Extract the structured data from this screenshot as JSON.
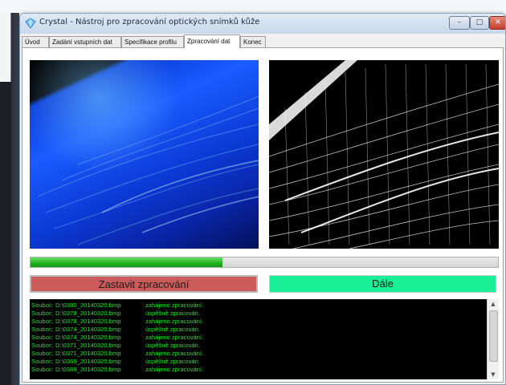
{
  "window": {
    "title": "Crystal - Nástroj pro zpracování optických snímků kůže",
    "buttons": {
      "minimize": "–",
      "maximize": "□",
      "close": "✕"
    }
  },
  "tabs": [
    {
      "label": "Úvod",
      "active": false
    },
    {
      "label": "Zadání vstupních dat",
      "active": false
    },
    {
      "label": "Specifikace profilu",
      "active": false
    },
    {
      "label": "Zpracování dat",
      "active": true
    },
    {
      "label": "Konec",
      "active": false
    }
  ],
  "progress": {
    "value": 0.41
  },
  "actions": {
    "stop_label": "Zastavit zpracování",
    "next_label": "Dále"
  },
  "colors": {
    "stop_button": "#cc5b5b",
    "next_button": "#19f098",
    "log_text": "#19e81f",
    "progress": "#1fb11f"
  },
  "log": [
    {
      "label": "Soubor:",
      "file": "D:\\0380_20140320.bmp",
      "status": "zahájeno zpracování."
    },
    {
      "label": "Soubor:",
      "file": "D:\\0378_20140320.bmp",
      "status": "úspěšně zpracován."
    },
    {
      "label": "Soubor:",
      "file": "D:\\0378_20140320.bmp",
      "status": "zahájeno zpracování."
    },
    {
      "label": "Soubor:",
      "file": "D:\\0374_20140320.bmp",
      "status": "úspěšně zpracován."
    },
    {
      "label": "Soubor:",
      "file": "D:\\0374_20140320.bmp",
      "status": "zahájeno zpracování."
    },
    {
      "label": "Soubor:",
      "file": "D:\\0371_20140320.bmp",
      "status": "úspěšně zpracován."
    },
    {
      "label": "Soubor:",
      "file": "D:\\0371_20140320.bmp",
      "status": "zahájeno zpracování."
    },
    {
      "label": "Soubor:",
      "file": "D:\\0369_20140320.bmp",
      "status": "úspěšně zpracován."
    },
    {
      "label": "Soubor:",
      "file": "D:\\0369_20140320.bmp",
      "status": "zahájeno zpracování."
    }
  ],
  "icons": [
    "crystal-app-icon",
    "scroll-up-icon",
    "scroll-down-icon"
  ]
}
